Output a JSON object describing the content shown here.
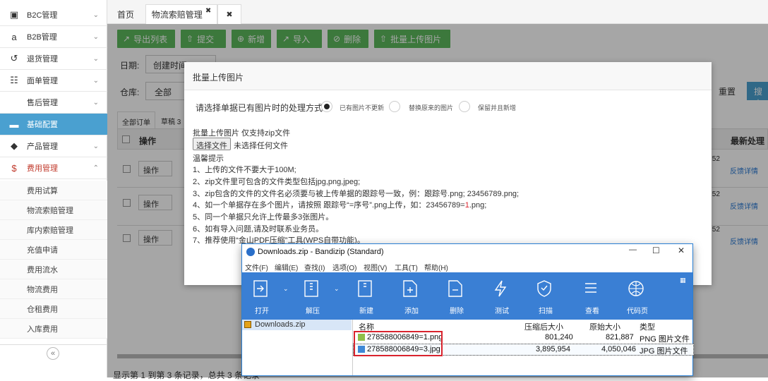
{
  "sidebar": {
    "items": [
      {
        "label": "B2C管理",
        "icon": "cart-icon",
        "glyph": "▣",
        "chev": "⌄"
      },
      {
        "label": "B2B管理",
        "icon": "amazon-icon",
        "glyph": "a",
        "chev": "⌄"
      },
      {
        "label": "退货管理",
        "icon": "return-icon",
        "glyph": "↺",
        "chev": "⌄"
      },
      {
        "label": "面单管理",
        "icon": "document-icon",
        "glyph": "☷",
        "chev": "⌄"
      },
      {
        "label": "售后管理",
        "icon": "service-icon",
        "glyph": "",
        "chev": "⌄"
      },
      {
        "label": "基础配置",
        "icon": "folder-icon",
        "glyph": "▬",
        "chev": ""
      },
      {
        "label": "产品管理",
        "icon": "tag-icon",
        "glyph": "◆",
        "chev": "⌄"
      },
      {
        "label": "费用管理",
        "icon": "dollar-icon",
        "glyph": "$",
        "chev": "⌃"
      }
    ],
    "subitems": [
      "费用试算",
      "物流索赔管理",
      "库内索赔管理",
      "充值申请",
      "费用流水",
      "物流费用",
      "仓租费用",
      "入库费用"
    ],
    "collapse_glyph": "«"
  },
  "tabs": [
    {
      "label": "首页"
    },
    {
      "label": "物流索赔管理",
      "close": "✖"
    },
    {
      "label": "✖"
    }
  ],
  "toolbar": [
    {
      "label": "导出列表",
      "glyph": "↗"
    },
    {
      "label": "提交",
      "glyph": "⇧"
    },
    {
      "label": "新增",
      "glyph": "⊕"
    },
    {
      "label": "导入",
      "glyph": "↗"
    },
    {
      "label": "删除",
      "glyph": "⊘"
    },
    {
      "label": "批量上传图片",
      "glyph": "⇧"
    }
  ],
  "filters": {
    "date_label": "日期:",
    "date_value": "创建时间",
    "warehouse_label": "仓库:",
    "warehouse_value": "全部",
    "reset": "重置",
    "search": "搜索"
  },
  "subtabs": [
    "全部订单",
    "草稿 3"
  ],
  "table": {
    "op_header": "操作",
    "latest_header": "最新处理",
    "op_button": "操作",
    "detail_link": "反馈详情",
    "time_fragment": ":52"
  },
  "footer": "显示第 1 到第 3 条记录，总共 3 条记录",
  "modal": {
    "title": "批量上传图片",
    "option_prompt": "请选择单据已有图片时的处理方式：",
    "options": [
      "已有图片不更新",
      "替换原来的图片",
      "保留并且新增"
    ],
    "upload_label": "批量上传图片 仅支持zip文件",
    "choose_button": "选择文件",
    "no_file": "未选择任何文件",
    "tips_title": "温馨提示",
    "tips": [
      "1、上传的文件不要大于100M;",
      "2、zip文件里可包含的文件类型包括jpg,png,jpeg;",
      "3、zip包含的文件的文件名必须要与被上传单据的跟踪号一致，例：跟踪号.png; 23456789.png;",
      "5、同一个单据只允许上传最多3张图片。",
      "6、如有导入问题,请及时联系业务员。",
      "7、推荐使用“金山PDF压缩”工具(WPS自带功能)。"
    ],
    "tip4_pre": "4、如一个单据存在多个图片，请按照 跟踪号“=序号”.png上传，如：23456789=",
    "tip4_red": "1",
    "tip4_post": ".png;"
  },
  "bandizip": {
    "title": "Downloads.zip - Bandizip (Standard)",
    "controls": [
      "—",
      "☐",
      "✕"
    ],
    "menu": [
      "文件(F)",
      "编辑(E)",
      "查找(I)",
      "选项(O)",
      "视图(V)",
      "工具(T)",
      "帮助(H)"
    ],
    "tools": [
      "打开",
      "解压",
      "新建",
      "添加",
      "删除",
      "测试",
      "扫描",
      "查看",
      "代码页"
    ],
    "tree_item": "Downloads.zip",
    "headers": {
      "name": "名称",
      "packed": "压缩后大小",
      "original": "原始大小",
      "type": "类型"
    },
    "files": [
      {
        "name": "278588006849=1.png",
        "packed": "801,240",
        "original": "821,887",
        "type": "PNG 图片文件"
      },
      {
        "name": "278588006849=3.jpg",
        "packed": "3,895,954",
        "original": "4,050,046",
        "type": "JPG 图片文件"
      }
    ]
  },
  "colors": {
    "green": "#5cb85c",
    "blue": "#3a7fd4",
    "active": "#4aa0d0",
    "red": "#d9232d",
    "link": "#2a7ad4"
  }
}
